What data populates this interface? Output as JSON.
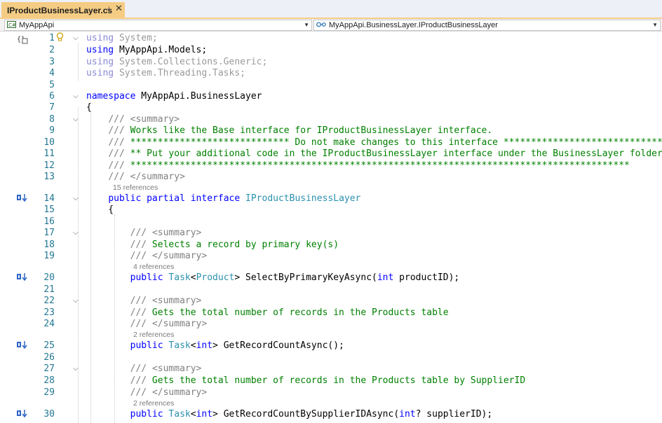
{
  "tab": {
    "title": "IProductBusinessLayer.cs",
    "pin_glyph": "⊣",
    "close_glyph": "✕"
  },
  "nav": {
    "project": "MyAppApi",
    "member": "MyAppApi.BusinessLayer.IProductBusinessLayer",
    "project_icon": "csharp-project-icon",
    "member_icon": "interface-icon"
  },
  "colors": {
    "keyword": "#0000ff",
    "type": "#2b91af",
    "comment": "#008000",
    "line_number": "#237893",
    "tab_active": "#f5cc84"
  },
  "editor": {
    "lines": [
      {
        "n": "1",
        "text": "using System;"
      },
      {
        "n": "2",
        "text": "using MyAppApi.Models;"
      },
      {
        "n": "3",
        "text": "using System.Collections.Generic;"
      },
      {
        "n": "4",
        "text": "using System.Threading.Tasks;"
      },
      {
        "n": "5",
        "text": ""
      },
      {
        "n": "6",
        "text": "namespace MyAppApi.BusinessLayer"
      },
      {
        "n": "7",
        "text": "{"
      },
      {
        "n": "8",
        "text": "    /// <summary>"
      },
      {
        "n": "9",
        "text": "    /// Works like the Base interface for IProductBusinessLayer interface."
      },
      {
        "n": "10",
        "text": "    /// ***************************** Do not make changes to this interface *****************************"
      },
      {
        "n": "11",
        "text": "    /// ** Put your additional code in the IProductBusinessLayer interface under the BusinessLayer folder. **"
      },
      {
        "n": "12",
        "text": "    /// *******************************************************************************************"
      },
      {
        "n": "13",
        "text": "    /// </summary>"
      },
      {
        "n": "14",
        "text": "    public partial interface IProductBusinessLayer"
      },
      {
        "n": "15",
        "text": "    {"
      },
      {
        "n": "16",
        "text": ""
      },
      {
        "n": "17",
        "text": "        /// <summary>"
      },
      {
        "n": "18",
        "text": "        /// Selects a record by primary key(s)"
      },
      {
        "n": "19",
        "text": "        /// </summary>"
      },
      {
        "n": "20",
        "text": "        public Task<Product> SelectByPrimaryKeyAsync(int productID);"
      },
      {
        "n": "21",
        "text": ""
      },
      {
        "n": "22",
        "text": "        /// <summary>"
      },
      {
        "n": "23",
        "text": "        /// Gets the total number of records in the Products table"
      },
      {
        "n": "24",
        "text": "        /// </summary>"
      },
      {
        "n": "25",
        "text": "        public Task<int> GetRecordCountAsync();"
      },
      {
        "n": "26",
        "text": ""
      },
      {
        "n": "27",
        "text": "        /// <summary>"
      },
      {
        "n": "28",
        "text": "        /// Gets the total number of records in the Products table by SupplierID"
      },
      {
        "n": "29",
        "text": "        /// </summary>"
      },
      {
        "n": "30",
        "text": "        public Task<int> GetRecordCountBySupplierIDAsync(int? supplierID);"
      }
    ],
    "codelens": {
      "iface_refs": "15 references",
      "select_refs": "4 references",
      "count_refs": "2 references",
      "count_supplier_refs": "2 references"
    },
    "gutter_icons": [
      "implementation-icon",
      "implementation-icon",
      "implementation-icon",
      "implementation-icon"
    ],
    "lightbulb_icon": "lightbulb-icon",
    "scope_icon": "scope-icon"
  }
}
